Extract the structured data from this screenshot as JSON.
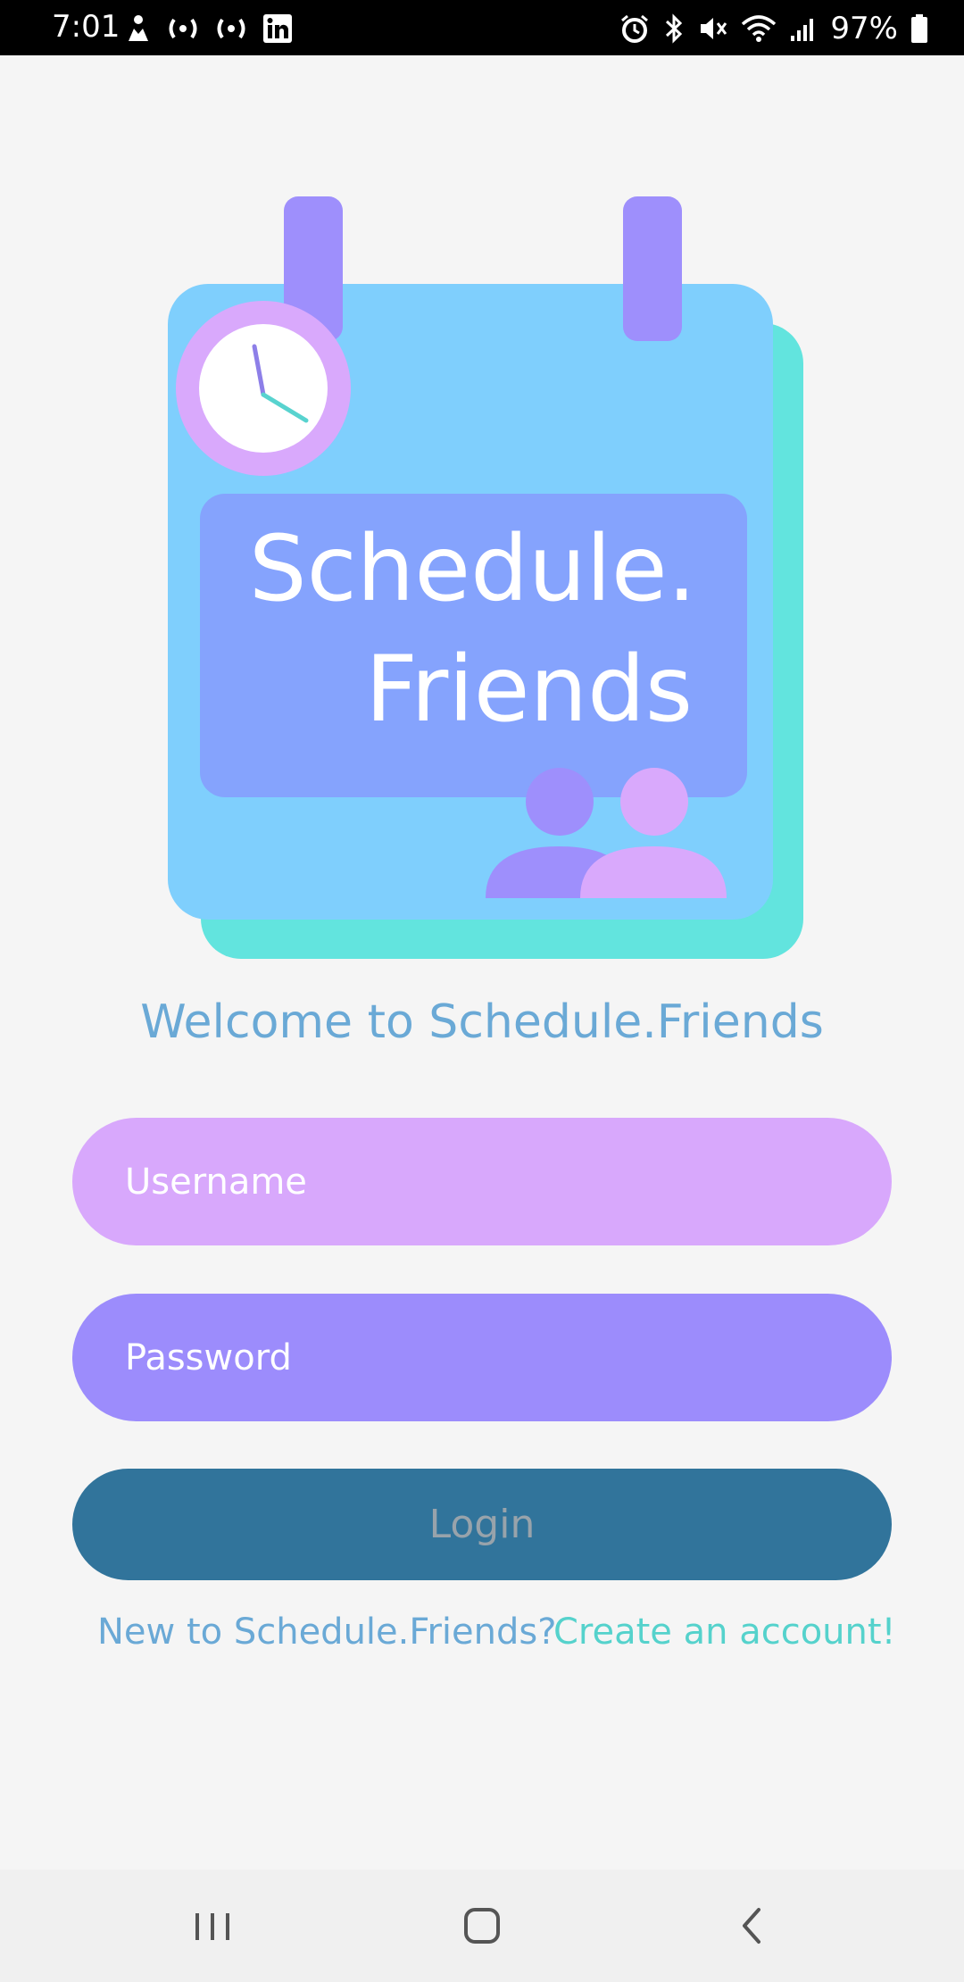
{
  "status_bar": {
    "time": "7:01",
    "battery": "97%",
    "left_icons": [
      "accessibility-icon",
      "broadcast-icon",
      "broadcast-icon",
      "linkedin-icon"
    ],
    "right_icons": [
      "alarm-icon",
      "bluetooth-icon",
      "mute-icon",
      "wifi-icon",
      "signal-icon",
      "battery-icon"
    ]
  },
  "logo": {
    "line1": "Schedule.",
    "line2": "Friends"
  },
  "welcome": "Welcome to Schedule.Friends",
  "form": {
    "username_placeholder": "Username",
    "password_placeholder": "Password",
    "login_label": "Login"
  },
  "signup": {
    "prompt": "New to Schedule.Friends?",
    "link": "Create an account!"
  },
  "colors": {
    "background": "#f5f5f5",
    "welcome_text": "#6aa9d6",
    "username_field": "#d8a8fc",
    "password_field": "#9c8cfc",
    "login_button": "#31749b",
    "link": "#55d2cc",
    "calendar_front": "#7fcffd",
    "calendar_back": "#62e4de",
    "logo_panel": "#85a3fd"
  },
  "nav_bar": {
    "buttons": [
      "recents-icon",
      "home-icon",
      "back-icon"
    ]
  }
}
